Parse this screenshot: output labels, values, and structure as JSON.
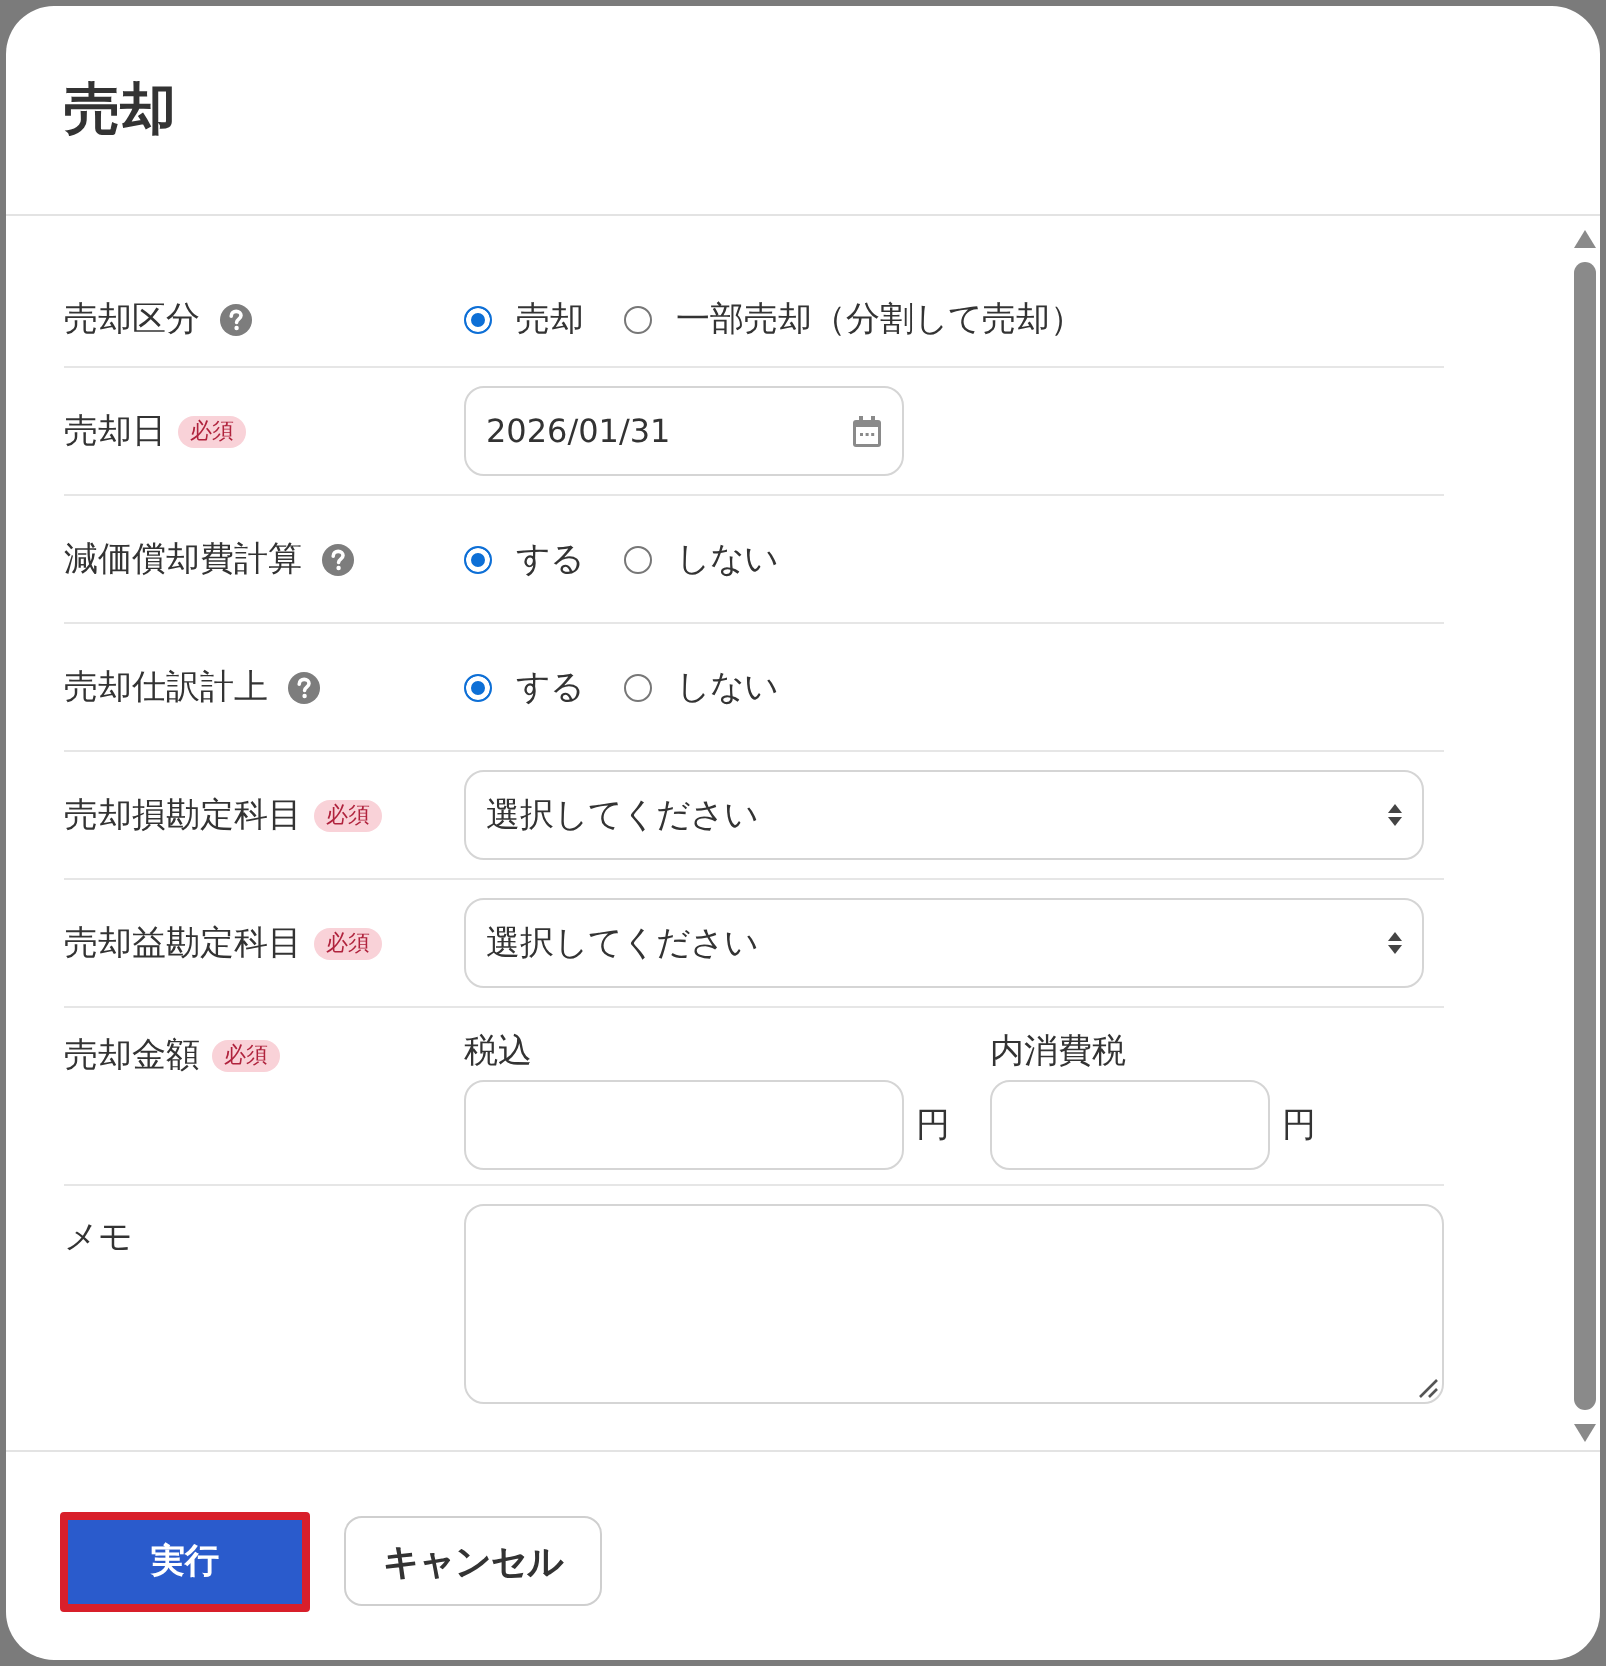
{
  "dialog": {
    "title": "売却"
  },
  "fields": [
    {
      "kind": "radio",
      "label": "売却区分",
      "help": true,
      "options": [
        {
          "label": "売却",
          "selected": true
        },
        {
          "label": "一部売却（分割して売却）",
          "selected": false
        }
      ]
    },
    {
      "kind": "date",
      "label": "売却日",
      "badge": "必須",
      "value": "2026/01/31"
    },
    {
      "kind": "radio",
      "label": "減価償却費計算",
      "help": true,
      "options": [
        {
          "label": "する",
          "selected": true
        },
        {
          "label": "しない",
          "selected": false
        }
      ]
    },
    {
      "kind": "radio",
      "label": "売却仕訳計上",
      "help": true,
      "options": [
        {
          "label": "する",
          "selected": true
        },
        {
          "label": "しない",
          "selected": false
        }
      ]
    },
    {
      "kind": "select",
      "label": "売却損勘定科目",
      "badge": "必須",
      "value": "選択してください"
    },
    {
      "kind": "select",
      "label": "売却益勘定科目",
      "badge": "必須",
      "value": "選択してください"
    },
    {
      "kind": "amount",
      "label": "売却金額",
      "badge": "必須",
      "inputs": [
        {
          "label": "税込",
          "unit": "円"
        },
        {
          "label": "内消費税",
          "unit": "円"
        }
      ]
    },
    {
      "kind": "textarea",
      "label": "メモ"
    }
  ],
  "buttons": [
    {
      "label": "実行",
      "kind": "primary",
      "highlighted": true
    },
    {
      "label": "キャンセル",
      "kind": "secondary",
      "highlighted": false
    }
  ]
}
